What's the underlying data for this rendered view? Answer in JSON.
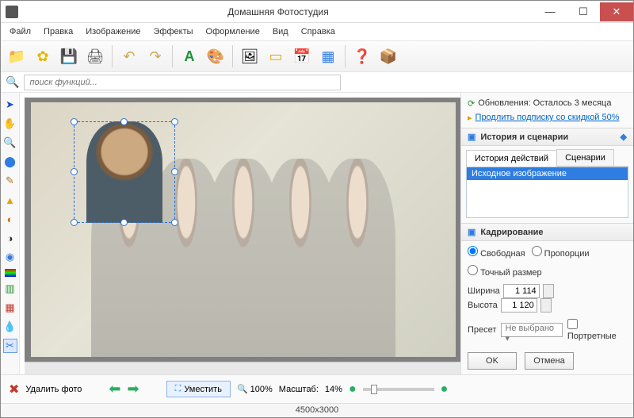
{
  "window": {
    "title": "Домашняя Фотостудия"
  },
  "menu": {
    "file": "Файл",
    "edit": "Правка",
    "image": "Изображение",
    "effects": "Эффекты",
    "design": "Оформление",
    "view": "Вид",
    "help": "Справка"
  },
  "search": {
    "placeholder": "поиск функций..."
  },
  "sidebar": {
    "update_line": "Обновления: Осталось  3 месяца",
    "extend_link": "Продлить подписку со скидкой 50%",
    "history_title": "История и сценарии",
    "tabs": {
      "history": "История действий",
      "scenarios": "Сценарии"
    },
    "history_item": "Исходное изображение",
    "crop_title": "Кадрирование",
    "mode": {
      "free": "Свободная",
      "prop": "Пропорции",
      "exact": "Точный размер"
    },
    "width_label": "Ширина",
    "width_value": "1 114",
    "height_label": "Высота",
    "height_value": "1 120",
    "preset_label": "Пресет",
    "preset_value": "Не выбрано",
    "portrait_label": "Портретные",
    "ok": "OK",
    "cancel": "Отмена"
  },
  "bottom": {
    "delete": "Удалить фото",
    "fit": "Уместить",
    "zoom_100": "100%",
    "scale_label": "Масштаб:",
    "scale_value": "14%"
  },
  "status": {
    "dims": "4500x3000"
  }
}
